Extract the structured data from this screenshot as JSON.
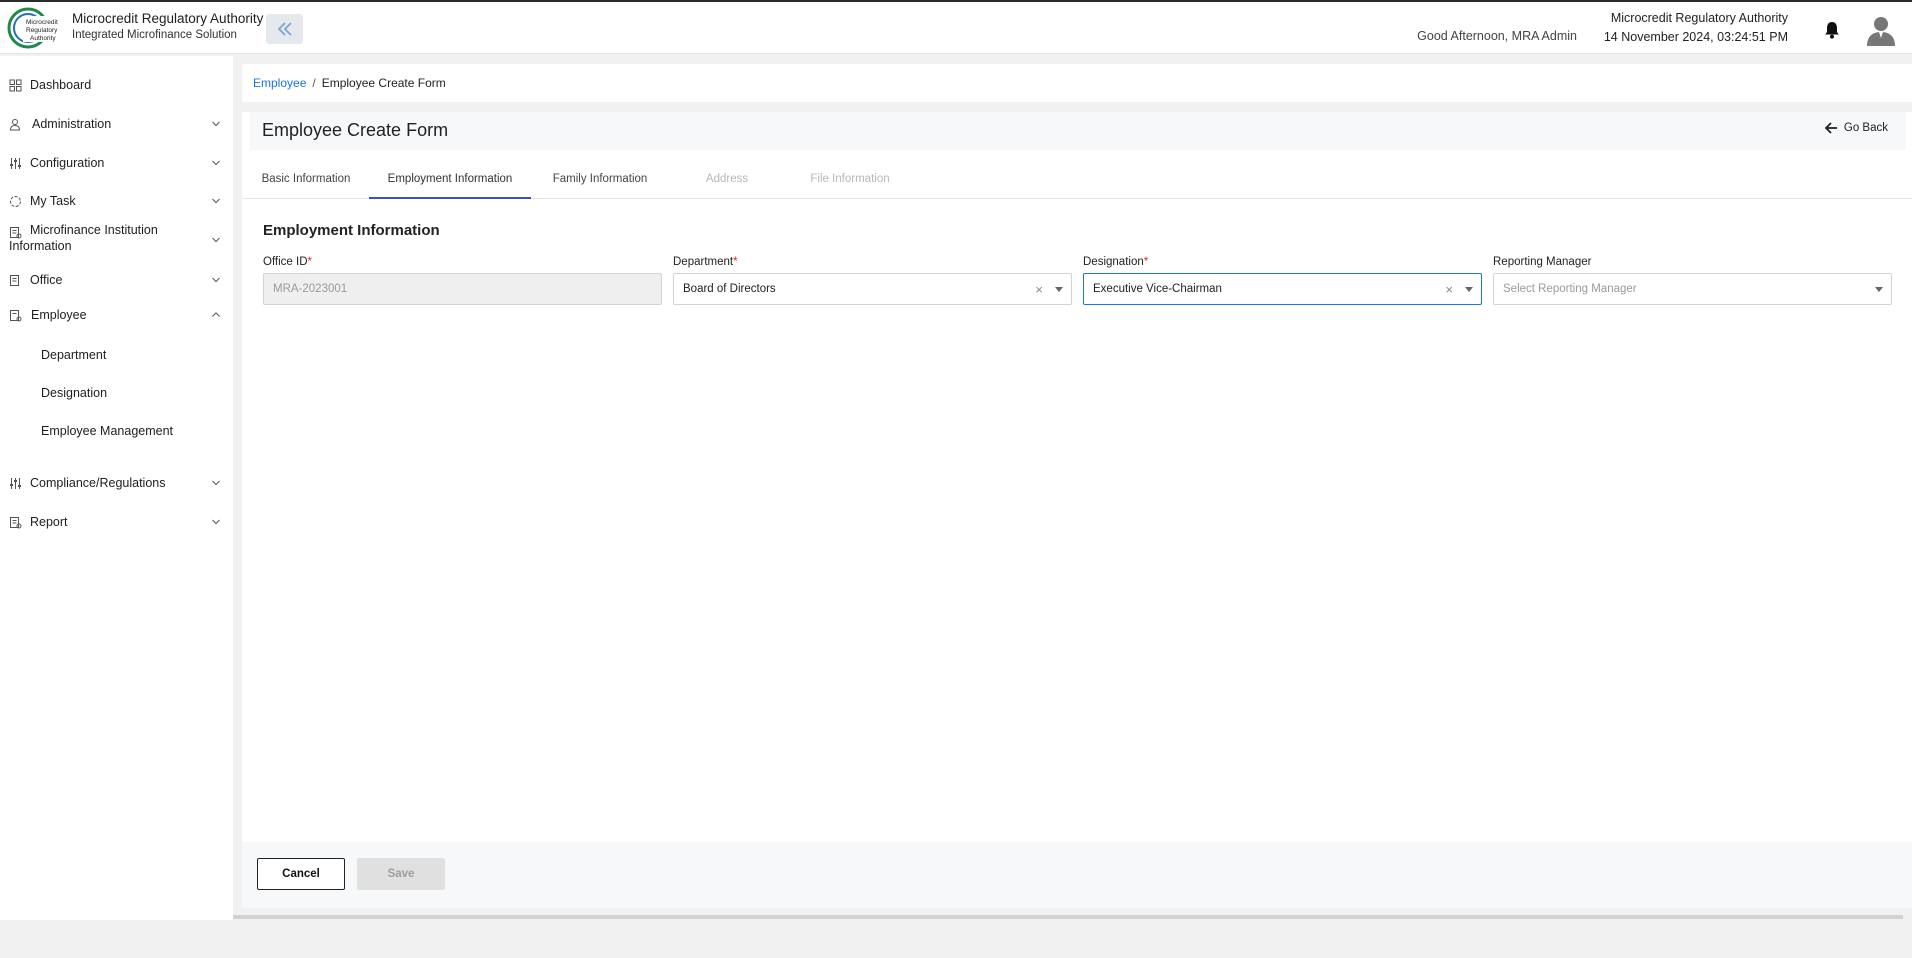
{
  "header": {
    "brand_title": "Microcredit Regulatory Authority",
    "brand_subtitle": "Integrated Microfinance Solution",
    "logo_text_1": "Microcredit",
    "logo_text_2": "Regulatory",
    "logo_text_3": "Authority",
    "greeting": "Good Afternoon, MRA Admin",
    "org_name": "Microcredit Regulatory Authority",
    "datetime": "14 November 2024, 03:24:51 PM"
  },
  "sidebar": {
    "items": [
      {
        "label": "Dashboard",
        "icon": "grid-icon"
      },
      {
        "label": "Administration",
        "icon": "user-gear-icon"
      },
      {
        "label": "Configuration",
        "icon": "sliders-icon"
      },
      {
        "label": "My Task",
        "icon": "task-circle-icon"
      },
      {
        "label": "Microfinance Institution Information",
        "icon": "institution-icon"
      },
      {
        "label": "Office",
        "icon": "office-icon"
      },
      {
        "label": "Employee",
        "icon": "employee-icon"
      },
      {
        "label": "Compliance/Regulations",
        "icon": "sliders-icon"
      },
      {
        "label": "Report",
        "icon": "report-icon"
      }
    ],
    "employee_sub": [
      "Department",
      "Designation",
      "Employee Management"
    ]
  },
  "breadcrumb": {
    "link": "Employee",
    "separator": "/",
    "current": "Employee Create Form"
  },
  "form": {
    "title": "Employee Create Form",
    "go_back": "Go Back",
    "tabs": [
      "Basic Information",
      "Employment Information",
      "Family Information",
      "Address",
      "File Information"
    ],
    "active_tab": "Employment Information",
    "section_title": "Employment Information",
    "fields": {
      "office_id": {
        "label": "Office ID",
        "required": "*",
        "value": "MRA-2023001"
      },
      "department": {
        "label": "Department",
        "required": "*",
        "value": "Board of Directors"
      },
      "designation": {
        "label": "Designation",
        "required": "*",
        "value": "Executive Vice-Chairman"
      },
      "reporting_manager": {
        "label": "Reporting Manager",
        "placeholder": "Select Reporting Manager"
      }
    },
    "cancel_label": "Cancel",
    "save_label": "Save"
  },
  "colors": {
    "accent": "#1a73e8",
    "tab_indicator": "#3f51b5",
    "required": "#e02424"
  }
}
